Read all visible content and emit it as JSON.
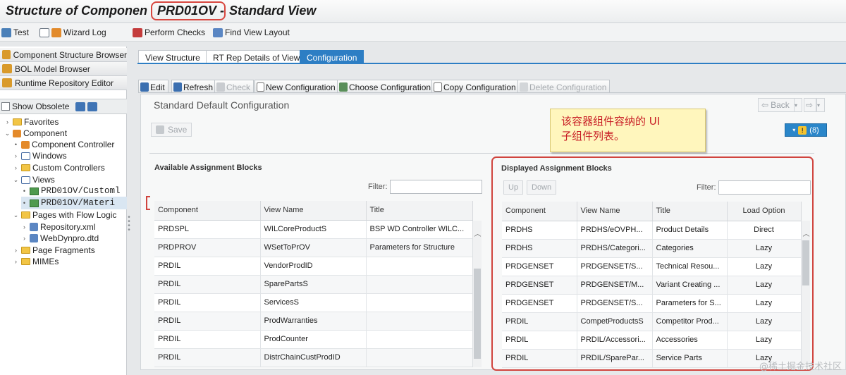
{
  "title": {
    "prefix": "Structure of Componen",
    "component": "PRD01OV",
    "dash": "-",
    "suffix": "Standard View"
  },
  "toolbar": {
    "test": "Test",
    "wizard_log": "Wizard Log",
    "perform_checks": "Perform Checks",
    "find_view_layout": "Find View Layout"
  },
  "left_nav": {
    "component_structure_browser": "Component Structure Browser",
    "bol_model_browser": "BOL Model Browser",
    "runtime_repository_editor": "Runtime Repository Editor"
  },
  "obsolete": {
    "label": "Show Obsolete"
  },
  "tree": {
    "favorites": "Favorites",
    "component": "Component",
    "component_controller": "Component Controller",
    "windows": "Windows",
    "custom_controllers": "Custom Controllers",
    "views": "Views",
    "view1": "PRD01OV/Customl",
    "view2": "PRD01OV/Materi",
    "pages_flow_logic": "Pages with Flow Logic",
    "repository_xml": "Repository.xml",
    "webdynpro_dtd": "WebDynpro.dtd",
    "page_fragments": "Page Fragments",
    "mimes": "MIMEs"
  },
  "tabs": [
    "View Structure",
    "RT Rep Details of View",
    "Configuration"
  ],
  "config_toolbar": {
    "edit": "Edit",
    "refresh": "Refresh",
    "check": "Check",
    "new_config": "New Configuration",
    "choose_config": "Choose Configuration",
    "copy_config": "Copy Configuration",
    "delete_config": "Delete Configuration"
  },
  "main": {
    "title": "Standard Default Configuration",
    "save": "Save",
    "back": "Back",
    "warnings": "(8)"
  },
  "callout": {
    "line1": "该容器组件容纳的 UI",
    "line2": "子组件列表。"
  },
  "available": {
    "title": "Available Assignment Blocks",
    "filter_label": "Filter:",
    "columns": [
      "Component",
      "View Name",
      "Title"
    ],
    "rows": [
      [
        "PRDSPL",
        "WILCoreProductS",
        "BSP WD Controller WILC..."
      ],
      [
        "PRDPROV",
        "WSetToPrOV",
        "Parameters for Structure"
      ],
      [
        "PRDIL",
        "VendorProdID",
        ""
      ],
      [
        "PRDIL",
        "SparePartsS",
        ""
      ],
      [
        "PRDIL",
        "ServicesS",
        ""
      ],
      [
        "PRDIL",
        "ProdWarranties",
        ""
      ],
      [
        "PRDIL",
        "ProdCounter",
        ""
      ],
      [
        "PRDIL",
        "DistrChainCustProdID",
        ""
      ]
    ]
  },
  "displayed": {
    "title": "Displayed Assignment Blocks",
    "up": "Up",
    "down": "Down",
    "filter_label": "Filter:",
    "columns": [
      "Component",
      "View Name",
      "Title",
      "Load Option"
    ],
    "rows": [
      [
        "PRDHS",
        "PRDHS/eOVPH...",
        "Product Details",
        "Direct"
      ],
      [
        "PRDHS",
        "PRDHS/Categori...",
        "Categories",
        "Lazy"
      ],
      [
        "PRDGENSET",
        "PRDGENSET/S...",
        "Technical Resou...",
        "Lazy"
      ],
      [
        "PRDGENSET",
        "PRDGENSET/M...",
        "Variant Creating ...",
        "Lazy"
      ],
      [
        "PRDGENSET",
        "PRDGENSET/S...",
        "Parameters for S...",
        "Lazy"
      ],
      [
        "PRDIL",
        "CompetProductsS",
        "Competitor Prod...",
        "Lazy"
      ],
      [
        "PRDIL",
        "PRDIL/Accessori...",
        "Accessories",
        "Lazy"
      ],
      [
        "PRDIL",
        "PRDIL/SparePar...",
        "Service Parts",
        "Lazy"
      ]
    ]
  },
  "watermark": "@稀土掘金技术社区",
  "colors": {
    "accent": "#2d7ec4",
    "highlight": "#d0443e",
    "callout_bg": "#fff6bd",
    "callout_text": "#c81d25"
  }
}
